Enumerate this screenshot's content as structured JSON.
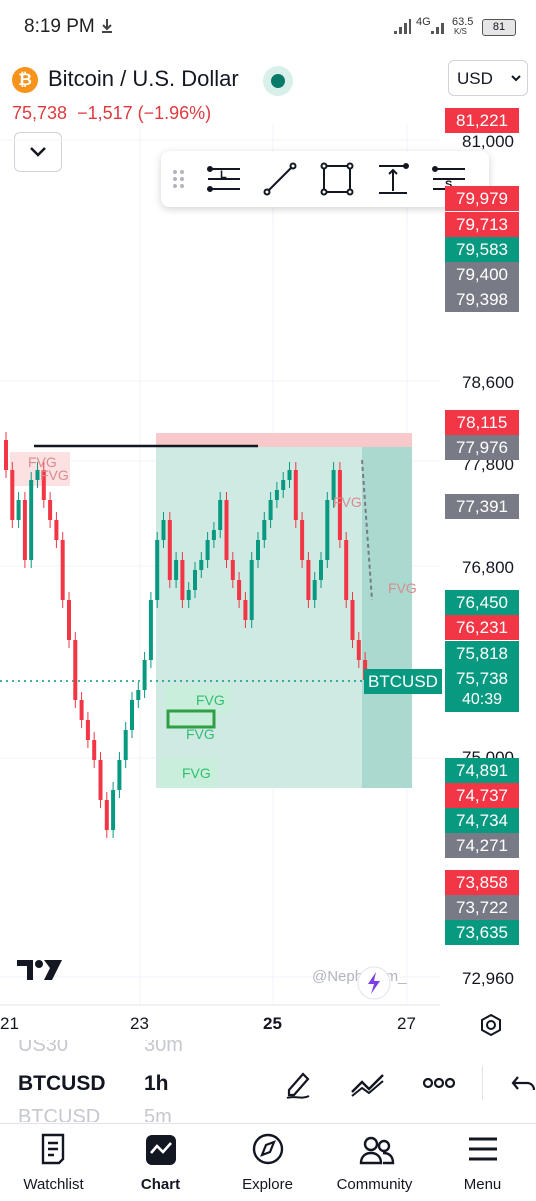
{
  "status_bar": {
    "time": "8:19 PM",
    "network": "4G",
    "speed": "63.5",
    "speed_unit": "K/S",
    "battery": "81"
  },
  "header": {
    "symbol_name": "Bitcoin / U.S. Dollar",
    "last_price": "75,738",
    "change": "−1,517 (−1.96%)",
    "currency": "USD"
  },
  "drawing_toolbar": {
    "tools": [
      "long-position-icon",
      "trendline-icon",
      "rectangle-icon",
      "measure-icon",
      "short-position-icon"
    ]
  },
  "price_axis": {
    "labels": [
      "81,000",
      "78,600",
      "77,800",
      "76,800",
      "75,000",
      "72,960"
    ],
    "badges": [
      {
        "value": "81,221",
        "color": "red"
      },
      {
        "value": "79,979",
        "color": "red"
      },
      {
        "value": "79,713",
        "color": "red"
      },
      {
        "value": "79,583",
        "color": "green"
      },
      {
        "value": "79,400",
        "color": "gray"
      },
      {
        "value": "79,398",
        "color": "gray"
      },
      {
        "value": "78,115",
        "color": "red"
      },
      {
        "value": "77,976",
        "color": "gray"
      },
      {
        "value": "77,391",
        "color": "gray"
      },
      {
        "value": "76,450",
        "color": "green"
      },
      {
        "value": "76,231",
        "color": "red"
      },
      {
        "value": "75,818",
        "color": "green"
      },
      {
        "value": "75,738",
        "color": "green"
      },
      {
        "value": "74,891",
        "color": "green"
      },
      {
        "value": "74,737",
        "color": "red"
      },
      {
        "value": "74,734",
        "color": "green"
      },
      {
        "value": "74,271",
        "color": "gray"
      },
      {
        "value": "73,858",
        "color": "red"
      },
      {
        "value": "73,722",
        "color": "gray"
      },
      {
        "value": "73,635",
        "color": "green"
      }
    ],
    "countdown": "40:39",
    "symbol_tag": "BTCUSD"
  },
  "time_axis": {
    "labels": [
      "21",
      "23",
      "25",
      "27"
    ]
  },
  "chart_labels": {
    "fvg": "FVG",
    "watermark": "@Neph   Sam_"
  },
  "symbol_bar": {
    "prev_symbol": "US30",
    "prev_interval": "30m",
    "symbol": "BTCUSD",
    "interval": "1h",
    "next_symbol": "BTCUSD",
    "next_interval": "5m"
  },
  "tabs": [
    "Watchlist",
    "Chart",
    "Explore",
    "Community",
    "Menu"
  ],
  "colors": {
    "up": "#089981",
    "down": "#f23645",
    "neutral": "#787b86"
  }
}
